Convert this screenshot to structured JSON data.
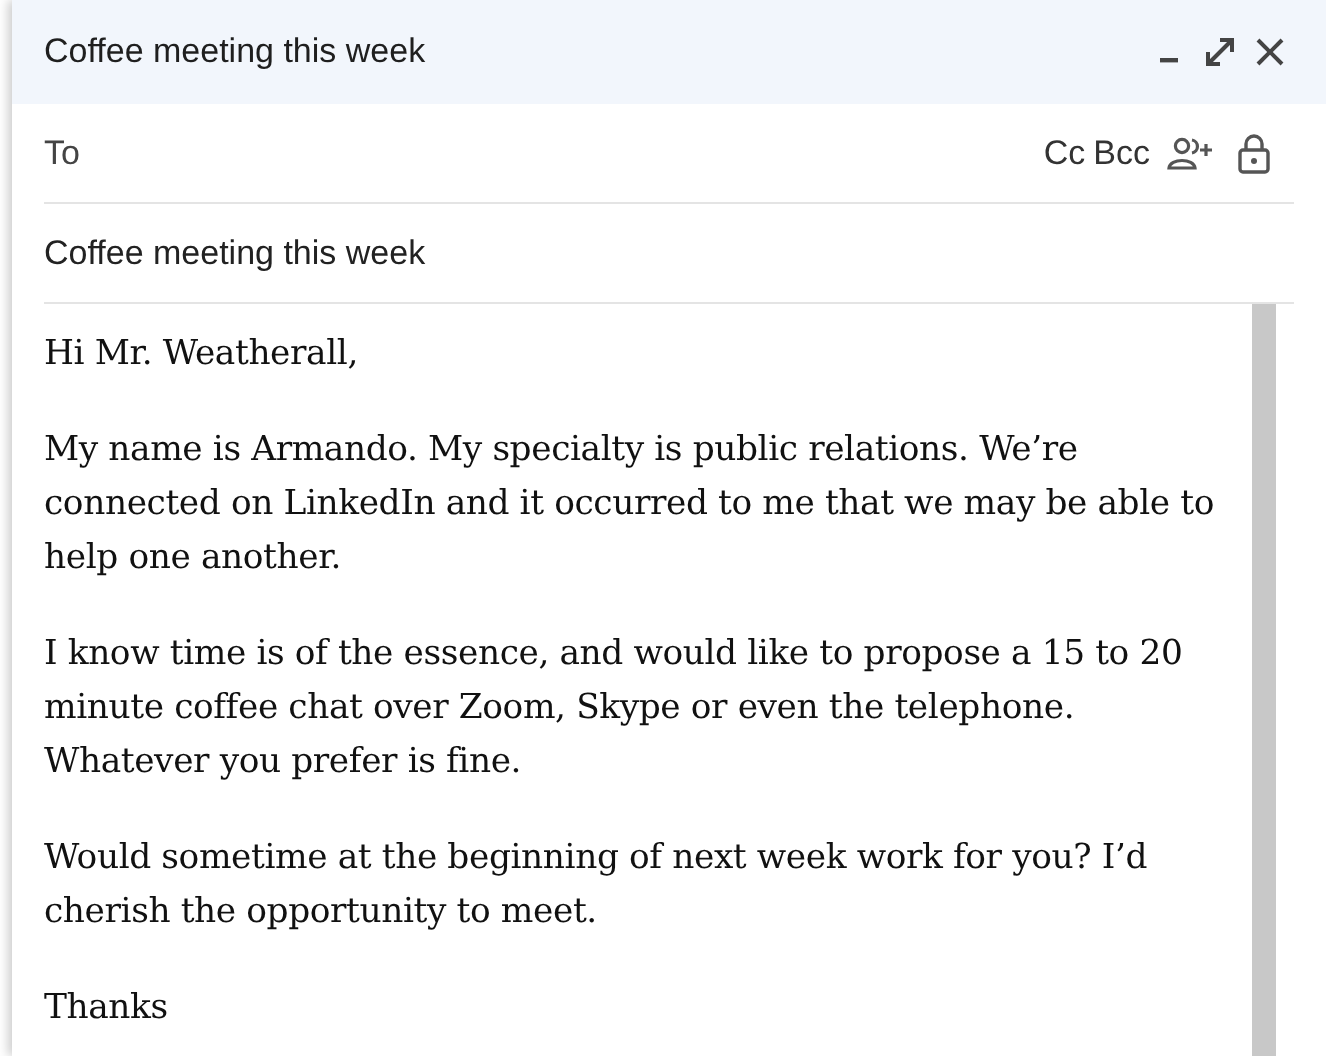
{
  "window": {
    "title": "Coffee meeting this week"
  },
  "recipients": {
    "label": "To",
    "cc": "Cc",
    "bcc": "Bcc"
  },
  "subject": {
    "value": "Coffee meeting this week"
  },
  "body": {
    "paragraphs": [
      "Hi Mr. Weatherall,",
      "My name is Armando. My specialty is public relations. We’re connected on LinkedIn and it occurred to me that we may be able to help one another.",
      "I know time is of the essence, and would like to propose a 15 to 20 minute coffee chat over Zoom, Skype or even the telephone. Whatever you prefer is fine.",
      "Would sometime at the beginning of next week work for you? I’d cherish the opportunity to meet.",
      "Thanks"
    ]
  }
}
